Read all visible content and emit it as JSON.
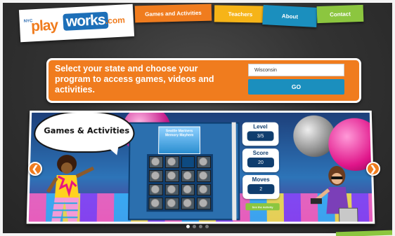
{
  "logo": {
    "prefix": "NYC",
    "play": "play",
    "works": "works",
    "suffix": ".com"
  },
  "nav": {
    "items": [
      {
        "label": "Games and Activities",
        "color": "#f07c1e"
      },
      {
        "label": "Teachers",
        "color": "#f6b418"
      },
      {
        "label": "About",
        "color": "#1b8fbe"
      },
      {
        "label": "Contact",
        "color": "#8cc63f"
      }
    ]
  },
  "selector": {
    "prompt": "Select your state and choose your program to access games, videos and activities.",
    "state_value": "Wisconsin",
    "go_label": "GO"
  },
  "game": {
    "bubble_text": "Games & Activities",
    "title_card": "Seattle Mariners Memory Mayhem",
    "tile_rows": [
      [
        "coin",
        "coin",
        "blank",
        "coin"
      ],
      [
        "coin",
        "coin",
        "coin",
        "coin"
      ],
      [
        "coin",
        "coin",
        "coin",
        "coin"
      ],
      [
        "coin",
        "coin",
        "coin",
        "coin"
      ]
    ],
    "stats": {
      "level_label": "Level",
      "level_value": "3/5",
      "score_label": "Score",
      "score_value": "20",
      "moves_label": "Moves",
      "moves_value": "2"
    },
    "see_activity_label": "See the Activity"
  },
  "carousel": {
    "prev_icon": "chevron-left-icon",
    "next_icon": "chevron-right-icon",
    "slide_count": 4,
    "active_index": 0
  },
  "colors": {
    "accent_orange": "#f07c1e",
    "accent_blue": "#1b8fbe",
    "accent_green": "#8cc63f",
    "accent_yellow": "#f6b418"
  }
}
